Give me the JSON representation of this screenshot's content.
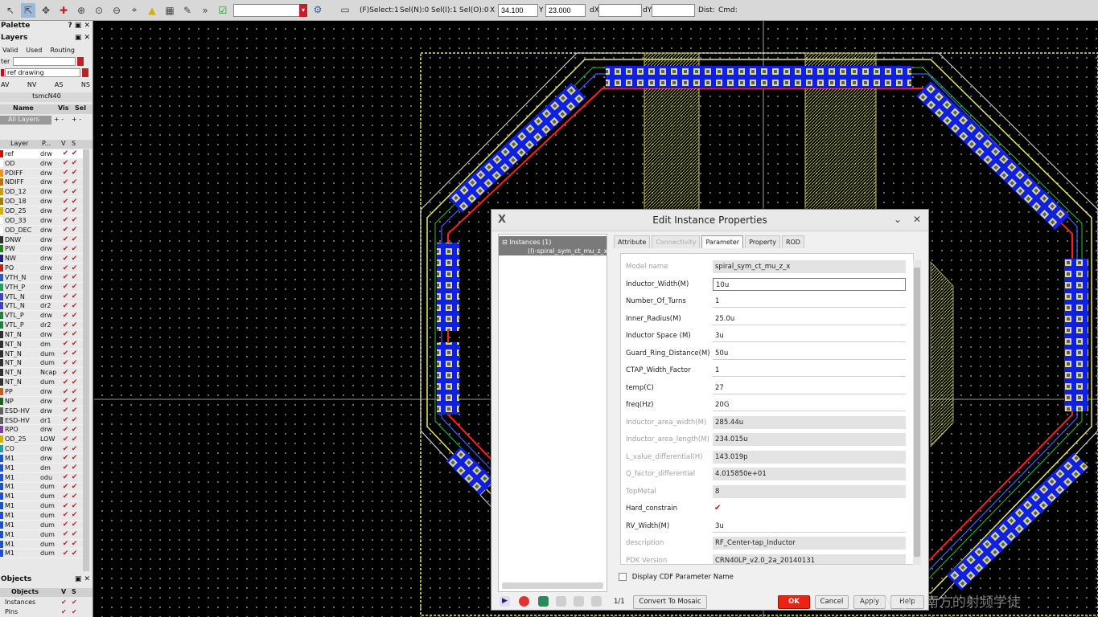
{
  "toolbar": {
    "search_value": "",
    "status": {
      "f_select": "(F)Select:1",
      "sel_n": "Sel(N):0",
      "sel_i": "Sel(I):1",
      "sel_o": "Sel(O):0"
    },
    "x_label": "X",
    "x_value": "34.100",
    "y_label": "Y",
    "y_value": "23.000",
    "dx_label": "dX",
    "dx_value": "",
    "dy_label": "dY",
    "dy_value": "",
    "dist_label": "Dist:",
    "cmd_label": "Cmd:"
  },
  "palette": {
    "title": "Palette",
    "layers_title": "Layers",
    "filter_valid": "Valid",
    "filter_used": "Used",
    "filter_routing": "Routing",
    "filter_label": "ter",
    "current_layer": "ref drawing",
    "shortcuts": [
      "AV",
      "NV",
      "AS",
      "NS"
    ],
    "techlib": "tsmcN40",
    "lpp_headers": {
      "name": "Name",
      "vis": "Vis",
      "sel": "Sel"
    },
    "all_layers": "All Layers",
    "layer_headers": {
      "layer": "Layer",
      "purpose": "P...",
      "v": "V",
      "s": "S"
    },
    "layers": [
      {
        "name": "ref",
        "purpose": "drw",
        "color": "#e00000"
      },
      {
        "name": "OD",
        "purpose": "drw",
        "color": "#ffffff"
      },
      {
        "name": "PDIFF",
        "purpose": "drw",
        "color": "#e8a000"
      },
      {
        "name": "NDIFF",
        "purpose": "drw",
        "color": "#c07000"
      },
      {
        "name": "OD_12",
        "purpose": "drw",
        "color": "#c4a000"
      },
      {
        "name": "OD_18",
        "purpose": "drw",
        "color": "#a08000"
      },
      {
        "name": "OD_25",
        "purpose": "drw",
        "color": "#d0b000"
      },
      {
        "name": "OD_33",
        "purpose": "drw",
        "color": "#ffffff"
      },
      {
        "name": "OD_DEC",
        "purpose": "drw",
        "color": "#ffffff"
      },
      {
        "name": "DNW",
        "purpose": "drw",
        "color": "#303030"
      },
      {
        "name": "PW",
        "purpose": "drw",
        "color": "#208020"
      },
      {
        "name": "NW",
        "purpose": "drw",
        "color": "#202080"
      },
      {
        "name": "PO",
        "purpose": "drw",
        "color": "#c02020"
      },
      {
        "name": "VTH_N",
        "purpose": "drw",
        "color": "#2060c0"
      },
      {
        "name": "VTH_P",
        "purpose": "drw",
        "color": "#20a060"
      },
      {
        "name": "VTL_N",
        "purpose": "drw",
        "color": "#4040c0"
      },
      {
        "name": "VTL_N",
        "purpose": "dr2",
        "color": "#4040c0"
      },
      {
        "name": "VTL_P",
        "purpose": "drw",
        "color": "#208040"
      },
      {
        "name": "VTL_P",
        "purpose": "dr2",
        "color": "#208040"
      },
      {
        "name": "NT_N",
        "purpose": "drw",
        "color": "#303030"
      },
      {
        "name": "NT_N",
        "purpose": "dm",
        "color": "#303030"
      },
      {
        "name": "NT_N",
        "purpose": "dum",
        "color": "#303030"
      },
      {
        "name": "NT_N",
        "purpose": "dum",
        "color": "#303030"
      },
      {
        "name": "NT_N",
        "purpose": "Ncap",
        "color": "#303030"
      },
      {
        "name": "NT_N",
        "purpose": "dum",
        "color": "#303030"
      },
      {
        "name": "PP",
        "purpose": "drw",
        "color": "#c06020"
      },
      {
        "name": "NP",
        "purpose": "drw",
        "color": "#206020"
      },
      {
        "name": "ESD-HV",
        "purpose": "drw",
        "color": "#606060"
      },
      {
        "name": "ESD-HV",
        "purpose": "dr1",
        "color": "#606060"
      },
      {
        "name": "RPO",
        "purpose": "drw",
        "color": "#8040a0"
      },
      {
        "name": "OD_25",
        "purpose": "LOW",
        "color": "#d0b000"
      },
      {
        "name": "CO",
        "purpose": "drw",
        "color": "#20a0a0"
      },
      {
        "name": "M1",
        "purpose": "drw",
        "color": "#2050d0"
      },
      {
        "name": "M1",
        "purpose": "dm",
        "color": "#2050d0"
      },
      {
        "name": "M1",
        "purpose": "odu",
        "color": "#2050d0"
      },
      {
        "name": "M1",
        "purpose": "dum",
        "color": "#2050d0"
      },
      {
        "name": "M1",
        "purpose": "dum",
        "color": "#2050d0"
      },
      {
        "name": "M1",
        "purpose": "dum",
        "color": "#2050d0"
      },
      {
        "name": "M1",
        "purpose": "dum",
        "color": "#2050d0"
      },
      {
        "name": "M1",
        "purpose": "dum",
        "color": "#2050d0"
      },
      {
        "name": "M1",
        "purpose": "dum",
        "color": "#2050d0"
      },
      {
        "name": "M1",
        "purpose": "dum",
        "color": "#2050d0"
      },
      {
        "name": "M1",
        "purpose": "dum",
        "color": "#2050d0"
      }
    ],
    "objects_title": "Objects",
    "objects_headers": {
      "name": "Objects",
      "v": "V",
      "s": "S"
    },
    "objects": [
      "Instances",
      "Pins"
    ]
  },
  "dialog": {
    "title": "Edit Instance Properties",
    "instances_header": "Instances (1)",
    "instance_item": "(I)-spiral_sym_ct_mu_z_x",
    "tabs": [
      {
        "label": "Attribute",
        "state": "normal"
      },
      {
        "label": "Connectivity",
        "state": "disabled"
      },
      {
        "label": "Parameter",
        "state": "active"
      },
      {
        "label": "Property",
        "state": "normal"
      },
      {
        "label": "ROD",
        "state": "normal"
      }
    ],
    "params": [
      {
        "label": "Model name",
        "value": "spiral_sym_ct_mu_z_x",
        "readonly": true,
        "dim": true
      },
      {
        "label": "Inductor_Width(M)",
        "value": "10u",
        "focus": true
      },
      {
        "label": "Number_Of_Turns",
        "value": "1"
      },
      {
        "label": "Inner_Radius(M)",
        "value": "25.0u"
      },
      {
        "label": "Inductor Space (M)",
        "value": "3u"
      },
      {
        "label": "Guard_Ring_Distance(M)",
        "value": "50u"
      },
      {
        "label": "CTAP_Width_Factor",
        "value": "1"
      },
      {
        "label": "temp(C)",
        "value": "27"
      },
      {
        "label": "freq(Hz)",
        "value": "20G"
      },
      {
        "label": "Inductor_area_width(M)",
        "value": "285.44u",
        "readonly": true,
        "dim": true
      },
      {
        "label": "Inductor_area_length(M)",
        "value": "234.015u",
        "readonly": true,
        "dim": true
      },
      {
        "label": "L_value_differential(H)",
        "value": "143.019p",
        "readonly": true,
        "dim": true
      },
      {
        "label": "Q_factor_differential",
        "value": "4.015850e+01",
        "readonly": true,
        "dim": true
      },
      {
        "label": "TopMetal",
        "value": "8",
        "readonly": true,
        "dim": true
      },
      {
        "label": "Hard_constrain",
        "value": "",
        "checkbox": true
      },
      {
        "label": "RV_Width(M)",
        "value": "3u"
      },
      {
        "label": "description",
        "value": "RF_Center-tap_Inductor",
        "readonly": true,
        "dim": true
      },
      {
        "label": "PDK Version",
        "value": "CRN40LP_v2.0_2a_20140131",
        "readonly": true,
        "dim": true
      }
    ],
    "display_cdf_label": "Display CDF Parameter Name",
    "page_indicator": "1/1",
    "convert_button": "Convert To Mosaic",
    "ok_button": "OK",
    "cancel_button": "Cancel",
    "apply_button": "Apply",
    "help_button": "Help"
  },
  "watermark": "CSDN @东南方的射频学徒",
  "colors": {
    "canvas_bg": "#000000",
    "ring_outer": "#e8e860",
    "ring_red": "#ff2020",
    "metal_blue": "#1020e0",
    "ok_button": "#e02010"
  }
}
